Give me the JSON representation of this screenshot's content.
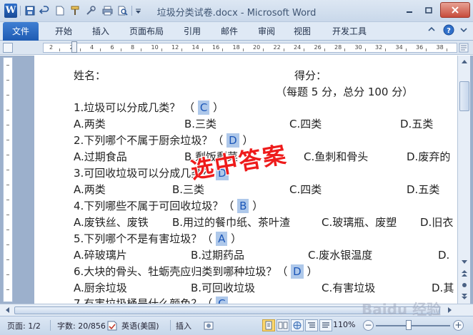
{
  "window": {
    "title": "垃圾分类试卷.docx - Microsoft Word",
    "app_icon_letter": "W"
  },
  "ribbon": {
    "tabs": [
      "文件",
      "开始",
      "插入",
      "页面布局",
      "引用",
      "邮件",
      "审阅",
      "视图",
      "开发工具"
    ]
  },
  "ruler": {
    "numbers": [
      "2",
      "2",
      "4",
      "6",
      "8",
      "10",
      "12",
      "14",
      "16",
      "18",
      "20",
      "22",
      "24",
      "26",
      "28",
      "30",
      "32",
      "34",
      "36",
      "38"
    ]
  },
  "document": {
    "name_label": "姓名：",
    "score_label": "得分：",
    "score_note": "（每题 5 分，总分 100 分）",
    "questions": [
      {
        "q_text": "1.垃圾可以分成几类？ （",
        "answer": "C",
        "q_close": "）",
        "options": [
          "A.两类",
          "B.三类",
          "C.四类",
          "D.五类"
        ]
      },
      {
        "q_text": "2.下列哪个不属于厨余垃圾？（",
        "answer": "D",
        "q_close": "）",
        "options": [
          "A.过期食品",
          "B.剩饭剩菜",
          "C.鱼刺和骨头",
          "D.废弃的"
        ]
      },
      {
        "q_text": "3.可回收垃圾可以分成几类？",
        "answer": "D",
        "q_close": "",
        "options": [
          "A.两类",
          "B.三类",
          "C.四类",
          "D.五类"
        ]
      },
      {
        "q_text": "4.下列哪些不属于可回收垃圾？（",
        "answer": "B",
        "q_close": "）",
        "options": [
          "A.废铁丝、废铁",
          "B.用过的餐巾纸、茶叶渣",
          "C.玻璃瓶、废塑",
          "D.旧衣"
        ]
      },
      {
        "q_text": "5.下列哪个不是有害垃圾？（",
        "answer": "A",
        "q_close": "）",
        "options": [
          "A.碎玻璃片",
          "B.过期药品",
          "C.废水银温度",
          "D."
        ]
      },
      {
        "q_text": "6.大块的骨头、牡蛎壳应归类到哪种垃圾？（",
        "answer": "D",
        "q_close": "）",
        "options": [
          "A.厨余垃圾",
          "B.可回收垃圾",
          "C.有害垃圾",
          "D.其"
        ]
      },
      {
        "q_text": "7.有害垃圾桶是什么颜色？（",
        "answer": "C",
        "q_close": "",
        "options": []
      }
    ],
    "stamp_text": "选中答案"
  },
  "statusbar": {
    "page": "页面: 1/2",
    "words": "字数: 20/856",
    "language": "英语(美国)",
    "mode": "插入",
    "zoom": "110%",
    "zoom_percent": 110
  },
  "watermark": "Baidu 经验"
}
